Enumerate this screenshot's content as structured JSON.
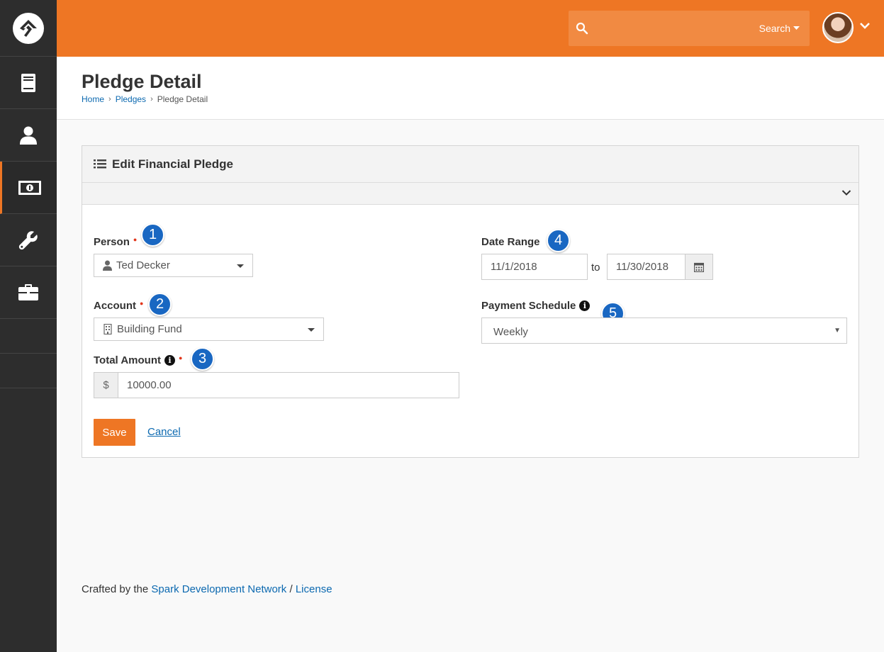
{
  "header": {
    "search_label": "Search"
  },
  "page": {
    "title": "Pledge Detail",
    "breadcrumb": [
      "Home",
      "Pledges",
      "Pledge Detail"
    ]
  },
  "panel": {
    "title": "Edit Financial Pledge"
  },
  "form": {
    "person": {
      "label": "Person",
      "value": "Ted Decker",
      "badge": "1"
    },
    "account": {
      "label": "Account",
      "value": "Building Fund",
      "badge": "2"
    },
    "total_amount": {
      "label": "Total Amount",
      "prefix": "$",
      "value": "10000.00",
      "badge": "3"
    },
    "date_range": {
      "label": "Date Range",
      "start": "11/1/2018",
      "separator": "to",
      "end": "11/30/2018",
      "badge": "4"
    },
    "payment_schedule": {
      "label": "Payment Schedule",
      "value": "Weekly",
      "badge": "5"
    },
    "info_glyph": "i"
  },
  "actions": {
    "save_label": "Save",
    "cancel_label": "Cancel"
  },
  "footer": {
    "prefix": "Crafted by the",
    "link1": "Spark Development Network",
    "divider": "/",
    "link2": "License"
  },
  "colors": {
    "brand": "#ee7624",
    "link": "#0c69b0",
    "badge": "#1967c2",
    "sidebar": "#2d2d2d"
  }
}
